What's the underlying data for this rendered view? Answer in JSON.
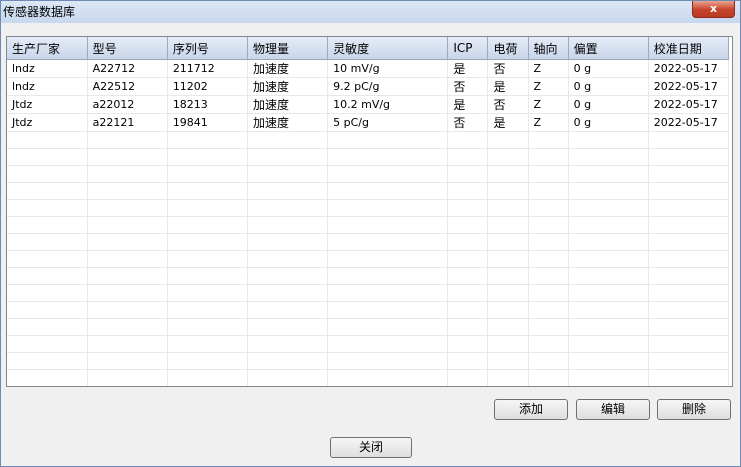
{
  "window": {
    "title": "传感器数据库",
    "close_glyph": "x"
  },
  "table": {
    "columns": [
      "生产厂家",
      "型号",
      "序列号",
      "物理量",
      "灵敏度",
      "ICP",
      "电荷",
      "轴向",
      "偏置",
      "校准日期"
    ],
    "rows": [
      [
        "lndz",
        "A22712",
        "211712",
        "加速度",
        "10 mV/g",
        "是",
        "否",
        "Z",
        "0 g",
        "2022-05-17"
      ],
      [
        "lndz",
        "A22512",
        "11202",
        "加速度",
        "9.2 pC/g",
        "否",
        "是",
        "Z",
        "0 g",
        "2022-05-17"
      ],
      [
        "Jtdz",
        "a22012",
        "18213",
        "加速度",
        "10.2 mV/g",
        "是",
        "否",
        "Z",
        "0 g",
        "2022-05-17"
      ],
      [
        "Jtdz",
        "a22121",
        "19841",
        "加速度",
        "5 pC/g",
        "否",
        "是",
        "Z",
        "0 g",
        "2022-05-17"
      ]
    ]
  },
  "buttons": {
    "add": "添加",
    "edit": "编辑",
    "delete": "删除",
    "close": "关闭"
  }
}
